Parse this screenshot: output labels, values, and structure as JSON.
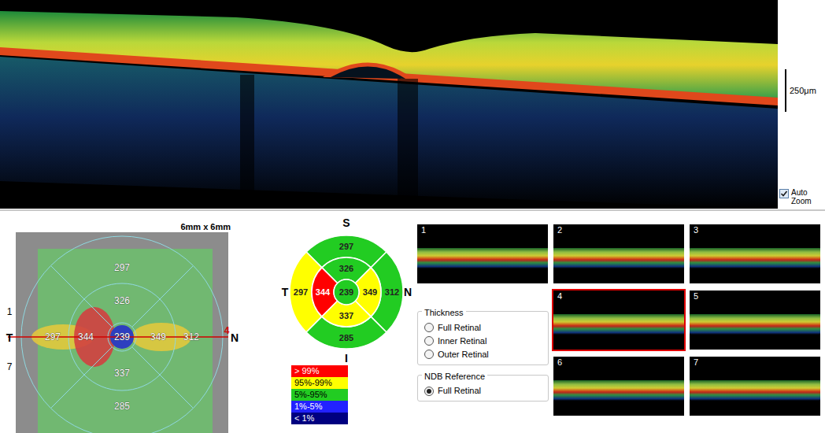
{
  "bscan": {
    "scale_label": "250μm",
    "auto_zoom": {
      "label": "Auto Zoom",
      "checked": true
    }
  },
  "map": {
    "size_label": "6mm x 6mm",
    "axis": {
      "temporal": "T",
      "nasal": "N"
    },
    "line_labels": [
      "1",
      "7"
    ],
    "scan_number": "4",
    "values": [
      {
        "sector": "outer-superior",
        "value": "297"
      },
      {
        "sector": "inner-superior",
        "value": "326"
      },
      {
        "sector": "outer-temporal",
        "value": "297"
      },
      {
        "sector": "inner-temporal",
        "value": "344"
      },
      {
        "sector": "center",
        "value": "239"
      },
      {
        "sector": "inner-nasal",
        "value": "349"
      },
      {
        "sector": "outer-nasal",
        "value": "312"
      },
      {
        "sector": "inner-inferior",
        "value": "337"
      },
      {
        "sector": "outer-inferior",
        "value": "285"
      }
    ]
  },
  "chart": {
    "directions": {
      "superior": "S",
      "temporal": "T",
      "nasal": "N",
      "inferior": "I"
    },
    "sectors": [
      {
        "sector": "outer-superior",
        "value": "297",
        "color": "#22cc22"
      },
      {
        "sector": "outer-temporal",
        "value": "297",
        "color": "#ffff00"
      },
      {
        "sector": "outer-nasal",
        "value": "312",
        "color": "#22cc22"
      },
      {
        "sector": "outer-inferior",
        "value": "285",
        "color": "#22cc22"
      },
      {
        "sector": "inner-superior",
        "value": "326",
        "color": "#22cc22"
      },
      {
        "sector": "inner-temporal",
        "value": "344",
        "color": "#ff0000"
      },
      {
        "sector": "inner-nasal",
        "value": "349",
        "color": "#ffff00"
      },
      {
        "sector": "inner-inferior",
        "value": "337",
        "color": "#ffff00"
      },
      {
        "sector": "center",
        "value": "239",
        "color": "#22cc22"
      }
    ]
  },
  "legend": [
    {
      "label": "> 99%",
      "color": "#ff0000"
    },
    {
      "label": "95%-99%",
      "color": "#ffff00"
    },
    {
      "label": "5%-95%",
      "color": "#22cc22"
    },
    {
      "label": "1%-5%",
      "color": "#2222ff"
    },
    {
      "label": "< 1%",
      "color": "#000080"
    }
  ],
  "thumbnails": [
    {
      "label": "1",
      "selected": false
    },
    {
      "label": "2",
      "selected": false
    },
    {
      "label": "3",
      "selected": false
    },
    {
      "label": "4",
      "selected": true
    },
    {
      "label": "5",
      "selected": false
    },
    {
      "label": "6",
      "selected": false
    },
    {
      "label": "7",
      "selected": false
    }
  ],
  "thickness": {
    "title": "Thickness",
    "options": [
      {
        "label": "Full Retinal",
        "selected": false
      },
      {
        "label": "Inner Retinal",
        "selected": false
      },
      {
        "label": "Outer Retinal",
        "selected": false
      }
    ]
  },
  "ndb": {
    "title": "NDB Reference",
    "options": [
      {
        "label": "Full Retinal",
        "selected": true
      }
    ]
  }
}
